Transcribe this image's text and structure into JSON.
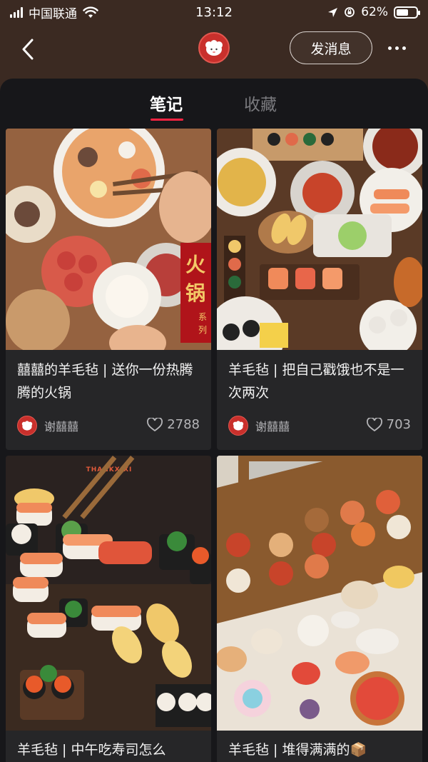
{
  "status_bar": {
    "carrier": "中国联通",
    "time": "13:12",
    "battery": "62%",
    "battery_level": 0.62
  },
  "header": {
    "message_button": "发消息",
    "icons": {
      "back": "chevron-left-icon",
      "more": "more-dots-icon",
      "avatar": "sheep-avatar"
    }
  },
  "tabs": [
    {
      "label": "笔记",
      "active": true
    },
    {
      "label": "收藏",
      "active": false
    }
  ],
  "notes": [
    {
      "title": "囍囍的羊毛毡 | 送你一份热腾腾的火锅",
      "author": "谢囍囍",
      "likes": "2788",
      "image": "felt-hotpot",
      "image_text": [
        "火",
        "锅",
        "系",
        "列"
      ]
    },
    {
      "title": "羊毛毡 | 把自己戳饿也不是一次两次",
      "author": "谢囍囍",
      "likes": "703",
      "image": "felt-sushi-platter"
    },
    {
      "title": "羊毛毡 | 中午吃寿司怎么",
      "image": "felt-sushi",
      "image_text": [
        "THANKXIXI"
      ]
    },
    {
      "title": "羊毛毡 | 堆得满满的📦",
      "image": "felt-food-box"
    }
  ],
  "colors": {
    "accent": "#ff2442",
    "header_bg": "#3b2a22",
    "sheet_bg": "#17171a",
    "card_bg": "#262628"
  }
}
